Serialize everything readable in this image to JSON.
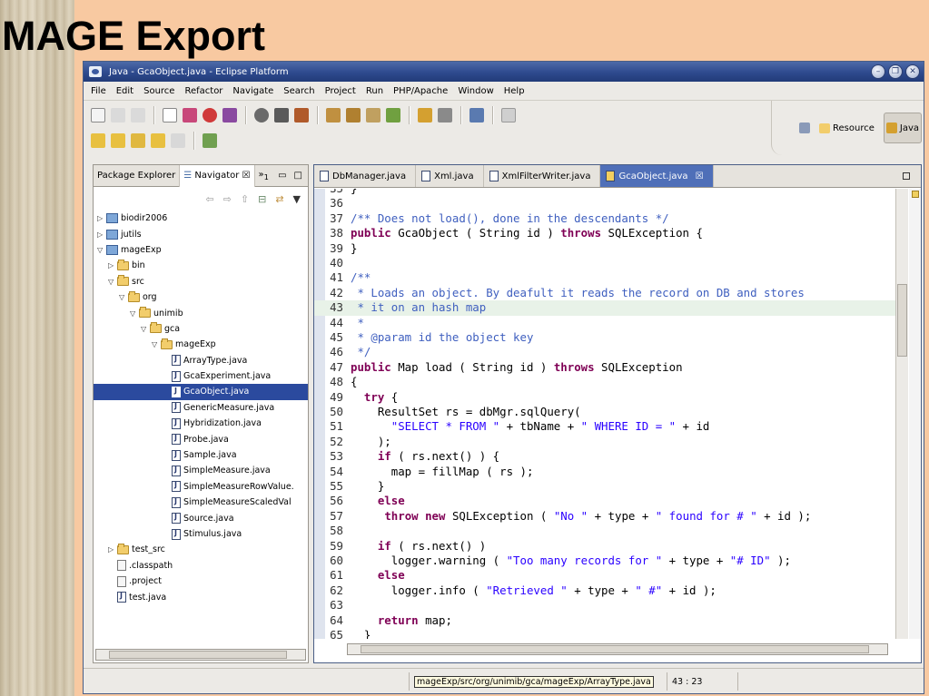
{
  "slide": {
    "title": "MAGE Export"
  },
  "window": {
    "title": "Java - GcaObject.java - Eclipse Platform",
    "controls": [
      "–",
      "❐",
      "✕"
    ]
  },
  "menu": [
    "File",
    "Edit",
    "Source",
    "Refactor",
    "Navigate",
    "Search",
    "Project",
    "Run",
    "PHP/Apache",
    "Window",
    "Help"
  ],
  "perspectives": {
    "resource": "Resource",
    "java": "Java"
  },
  "left_panel": {
    "tabs": {
      "package_explorer": "Package Explorer",
      "navigator": "Navigator",
      "overflow": "»",
      "overflow_count": "1"
    },
    "tree": [
      {
        "label": "biodir2006",
        "indent": 0,
        "type": "project",
        "twisty": "▷"
      },
      {
        "label": "jutils",
        "indent": 0,
        "type": "project",
        "twisty": "▷"
      },
      {
        "label": "mageExp",
        "indent": 0,
        "type": "project",
        "twisty": "▽"
      },
      {
        "label": "bin",
        "indent": 1,
        "type": "folder",
        "twisty": "▷"
      },
      {
        "label": "src",
        "indent": 1,
        "type": "folder",
        "twisty": "▽"
      },
      {
        "label": "org",
        "indent": 2,
        "type": "folder",
        "twisty": "▽"
      },
      {
        "label": "unimib",
        "indent": 3,
        "type": "folder",
        "twisty": "▽"
      },
      {
        "label": "gca",
        "indent": 4,
        "type": "folder",
        "twisty": "▽"
      },
      {
        "label": "mageExp",
        "indent": 5,
        "type": "folder",
        "twisty": "▽"
      },
      {
        "label": "ArrayType.java",
        "indent": 6,
        "type": "java",
        "twisty": ""
      },
      {
        "label": "GcaExperiment.java",
        "indent": 6,
        "type": "java",
        "twisty": ""
      },
      {
        "label": "GcaObject.java",
        "indent": 6,
        "type": "java",
        "twisty": "",
        "selected": true
      },
      {
        "label": "GenericMeasure.java",
        "indent": 6,
        "type": "java",
        "twisty": ""
      },
      {
        "label": "Hybridization.java",
        "indent": 6,
        "type": "java",
        "twisty": ""
      },
      {
        "label": "Probe.java",
        "indent": 6,
        "type": "java",
        "twisty": ""
      },
      {
        "label": "Sample.java",
        "indent": 6,
        "type": "java",
        "twisty": ""
      },
      {
        "label": "SimpleMeasure.java",
        "indent": 6,
        "type": "java",
        "twisty": ""
      },
      {
        "label": "SimpleMeasureRowValue.",
        "indent": 6,
        "type": "java",
        "twisty": ""
      },
      {
        "label": "SimpleMeasureScaledVal",
        "indent": 6,
        "type": "java",
        "twisty": ""
      },
      {
        "label": "Source.java",
        "indent": 6,
        "type": "java",
        "twisty": ""
      },
      {
        "label": "Stimulus.java",
        "indent": 6,
        "type": "java",
        "twisty": ""
      },
      {
        "label": "test_src",
        "indent": 1,
        "type": "folder",
        "twisty": "▷"
      },
      {
        "label": ".classpath",
        "indent": 1,
        "type": "file",
        "twisty": ""
      },
      {
        "label": ".project",
        "indent": 1,
        "type": "file",
        "twisty": ""
      },
      {
        "label": "test.java",
        "indent": 1,
        "type": "java",
        "twisty": ""
      }
    ]
  },
  "editor": {
    "tabs": [
      {
        "label": "DbManager.java",
        "active": false
      },
      {
        "label": "Xml.java",
        "active": false
      },
      {
        "label": "XmlFilterWriter.java",
        "active": false
      },
      {
        "label": "GcaObject.java",
        "active": true
      }
    ],
    "lines": [
      {
        "n": "35",
        "tokens": [
          [
            "",
            "}"
          ]
        ]
      },
      {
        "n": "36",
        "tokens": []
      },
      {
        "n": "37",
        "tokens": [
          [
            "cm",
            "/** Does not load(), done in the descendants */"
          ]
        ]
      },
      {
        "n": "38",
        "tokens": [
          [
            "kw",
            "public"
          ],
          [
            "",
            " GcaObject ( String id ) "
          ],
          [
            "kw",
            "throws"
          ],
          [
            "",
            " SQLException {"
          ]
        ]
      },
      {
        "n": "39",
        "tokens": [
          [
            "",
            "}"
          ]
        ]
      },
      {
        "n": "40",
        "tokens": []
      },
      {
        "n": "41",
        "tokens": [
          [
            "cm",
            "/**"
          ]
        ]
      },
      {
        "n": "42",
        "tokens": [
          [
            "cm",
            " * Loads an object. By deafult it reads the record on DB and stores"
          ]
        ]
      },
      {
        "n": "43",
        "tokens": [
          [
            "cm",
            " * it on an hash map"
          ]
        ],
        "highlight": true
      },
      {
        "n": "44",
        "tokens": [
          [
            "cm",
            " *"
          ]
        ]
      },
      {
        "n": "45",
        "tokens": [
          [
            "cm",
            " * @param id the object key"
          ]
        ]
      },
      {
        "n": "46",
        "tokens": [
          [
            "cm",
            " */"
          ]
        ]
      },
      {
        "n": "47",
        "tokens": [
          [
            "kw",
            "public"
          ],
          [
            "",
            " Map load ( String id ) "
          ],
          [
            "kw",
            "throws"
          ],
          [
            "",
            " SQLException"
          ]
        ]
      },
      {
        "n": "48",
        "tokens": [
          [
            "",
            "{"
          ]
        ]
      },
      {
        "n": "49",
        "tokens": [
          [
            "",
            "  "
          ],
          [
            "kw",
            "try"
          ],
          [
            "",
            " {"
          ]
        ]
      },
      {
        "n": "50",
        "tokens": [
          [
            "",
            "    ResultSet rs = dbMgr.sqlQuery("
          ]
        ]
      },
      {
        "n": "51",
        "tokens": [
          [
            "",
            "      "
          ],
          [
            "st",
            "\"SELECT * FROM \""
          ],
          [
            "",
            " + tbName + "
          ],
          [
            "st",
            "\" WHERE ID = \""
          ],
          [
            "",
            " + id"
          ]
        ]
      },
      {
        "n": "52",
        "tokens": [
          [
            "",
            "    );"
          ]
        ]
      },
      {
        "n": "53",
        "tokens": [
          [
            "",
            "    "
          ],
          [
            "kw",
            "if"
          ],
          [
            "",
            " ( rs.next() ) {"
          ]
        ]
      },
      {
        "n": "54",
        "tokens": [
          [
            "",
            "      map = fillMap ( rs );"
          ]
        ]
      },
      {
        "n": "55",
        "tokens": [
          [
            "",
            "    }"
          ]
        ]
      },
      {
        "n": "56",
        "tokens": [
          [
            "",
            "    "
          ],
          [
            "kw",
            "else"
          ]
        ]
      },
      {
        "n": "57",
        "tokens": [
          [
            "",
            "     "
          ],
          [
            "kw",
            "throw"
          ],
          [
            "",
            " "
          ],
          [
            "kw",
            "new"
          ],
          [
            "",
            " SQLException ( "
          ],
          [
            "st",
            "\"No \""
          ],
          [
            "",
            " + type + "
          ],
          [
            "st",
            "\" found for # \""
          ],
          [
            "",
            " + id );"
          ]
        ]
      },
      {
        "n": "58",
        "tokens": []
      },
      {
        "n": "59",
        "tokens": [
          [
            "",
            "    "
          ],
          [
            "kw",
            "if"
          ],
          [
            "",
            " ( rs.next() )"
          ]
        ]
      },
      {
        "n": "60",
        "tokens": [
          [
            "",
            "      logger.warning ( "
          ],
          [
            "st",
            "\"Too many records for \""
          ],
          [
            "",
            " + type + "
          ],
          [
            "st",
            "\"# ID\""
          ],
          [
            "",
            " );"
          ]
        ]
      },
      {
        "n": "61",
        "tokens": [
          [
            "",
            "    "
          ],
          [
            "kw",
            "else"
          ]
        ]
      },
      {
        "n": "62",
        "tokens": [
          [
            "",
            "      logger.info ( "
          ],
          [
            "st",
            "\"Retrieved \""
          ],
          [
            "",
            " + type + "
          ],
          [
            "st",
            "\" #\""
          ],
          [
            "",
            " + id );"
          ]
        ]
      },
      {
        "n": "63",
        "tokens": []
      },
      {
        "n": "64",
        "tokens": [
          [
            "",
            "    "
          ],
          [
            "kw",
            "return"
          ],
          [
            "",
            " map;"
          ]
        ]
      },
      {
        "n": "65",
        "tokens": [
          [
            "",
            "  }"
          ]
        ]
      }
    ]
  },
  "status": {
    "path": "mageExp/src/org/unimib/gca/mageExp/ArrayType.java",
    "position": "43 : 23"
  },
  "colors": {
    "selection": "#2b4a9e",
    "keyword": "#7f0055",
    "comment": "#3f5fbf",
    "string": "#2a00ff",
    "active_tab": "#4f6fb8"
  }
}
